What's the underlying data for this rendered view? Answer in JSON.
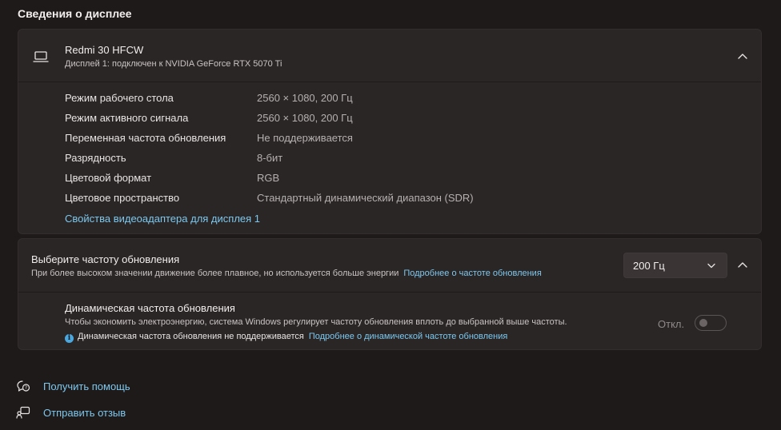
{
  "section_title": "Сведения о дисплее",
  "display_card": {
    "name": "Redmi 30 HFCW",
    "subtitle": "Дисплей 1: подключен к NVIDIA GeForce RTX 5070 Ti",
    "icon": "laptop-icon",
    "rows": [
      {
        "label": "Режим рабочего стола",
        "value": "2560 × 1080, 200 Гц"
      },
      {
        "label": "Режим активного сигнала",
        "value": "2560 × 1080, 200 Гц"
      },
      {
        "label": "Переменная частота обновления",
        "value": "Не поддерживается"
      },
      {
        "label": "Разрядность",
        "value": "8-бит"
      },
      {
        "label": "Цветовой формат",
        "value": "RGB"
      },
      {
        "label": "Цветовое пространство",
        "value": "Стандартный динамический диапазон (SDR)"
      }
    ],
    "adapter_link": "Свойства видеоадаптера для дисплея 1"
  },
  "refresh_card": {
    "title": "Выберите частоту обновления",
    "description": "При более высоком значении движение более плавное, но используется больше энергии",
    "learn_more": "Подробнее о частоте обновления",
    "selected_rate": "200 Гц",
    "dynamic": {
      "title": "Динамическая частота обновления",
      "description": "Чтобы экономить электроэнергию, система Windows регулирует частоту обновления вплоть до выбранной выше частоты.",
      "note": "Динамическая частота обновления не поддерживается",
      "note_link": "Подробнее о динамической частоте обновления",
      "toggle_state": "Откл.",
      "enabled": false
    }
  },
  "footer": {
    "help": "Получить помощь",
    "feedback": "Отправить отзыв"
  },
  "colors": {
    "background": "#1f1a1a",
    "card": "#2b2626",
    "link": "#7cc8ee"
  }
}
